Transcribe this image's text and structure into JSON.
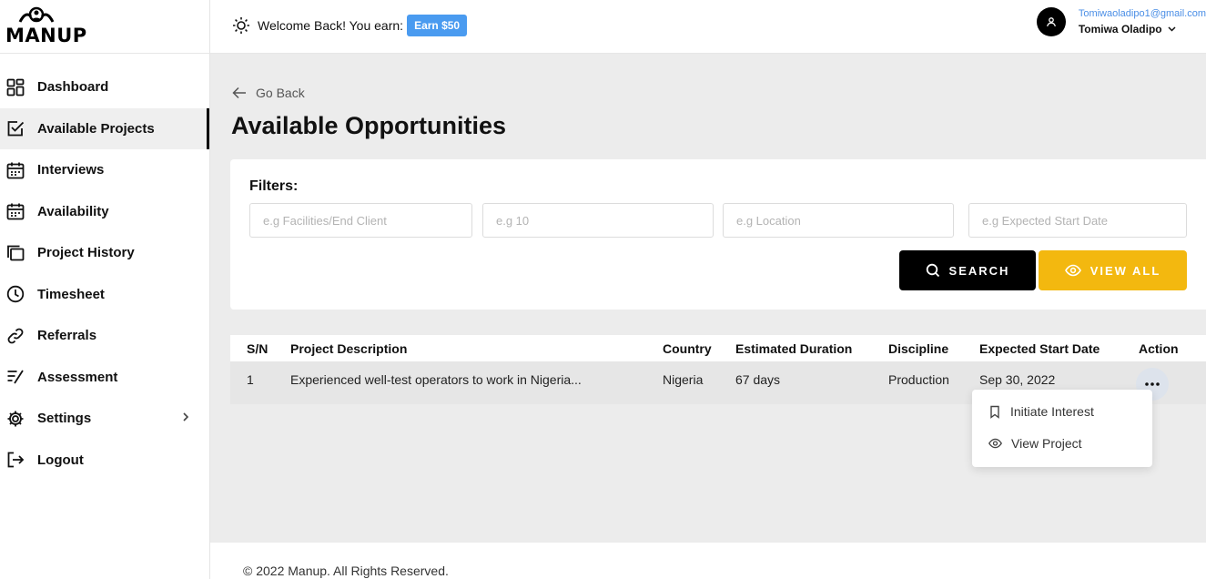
{
  "brand": {
    "name": "MANUP"
  },
  "sidebar": {
    "items": [
      {
        "label": "Dashboard",
        "icon": "grid-icon"
      },
      {
        "label": "Available Projects",
        "icon": "check-square-icon",
        "active": true
      },
      {
        "label": "Interviews",
        "icon": "calendar-icon"
      },
      {
        "label": "Availability",
        "icon": "calendar-icon"
      },
      {
        "label": "Project History",
        "icon": "folders-icon"
      },
      {
        "label": "Timesheet",
        "icon": "clock-icon"
      },
      {
        "label": "Referrals",
        "icon": "link-icon"
      },
      {
        "label": "Assessment",
        "icon": "assessment-icon"
      },
      {
        "label": "Settings",
        "icon": "gear-icon"
      },
      {
        "label": "Logout",
        "icon": "logout-icon"
      }
    ]
  },
  "header": {
    "welcome_text": "Welcome Back! You earn:",
    "earn_badge": "Earn $50",
    "user_email": "Tomiwaoladipo1@gmail.com",
    "user_name": "Tomiwa Oladipo"
  },
  "main": {
    "go_back": "Go Back",
    "title": "Available Opportunities",
    "filters": {
      "label": "Filters:",
      "fields": [
        {
          "placeholder": "e.g Facilities/End Client",
          "value": ""
        },
        {
          "placeholder": "e.g 10",
          "value": ""
        },
        {
          "placeholder": "e.g Location",
          "value": ""
        },
        {
          "placeholder": "e.g Expected Start Date",
          "value": ""
        }
      ],
      "search_label": "SEARCH",
      "view_all_label": "VIEW ALL"
    },
    "table": {
      "columns": [
        "S/N",
        "Project Description",
        "Country",
        "Estimated Duration",
        "Discipline",
        "Expected Start Date",
        "Action"
      ],
      "rows": [
        {
          "sn": "1",
          "description": "Experienced well-test operators to work in Nigeria...",
          "country": "Nigeria",
          "duration": "67 days",
          "discipline": "Production",
          "start_date": "Sep 30, 2022"
        }
      ]
    },
    "action_menu": {
      "items": [
        {
          "label": "Initiate Interest",
          "icon": "bookmark-icon"
        },
        {
          "label": "View Project",
          "icon": "eye-icon"
        }
      ]
    }
  },
  "footer": {
    "text": "© 2022 Manup. All Rights Reserved."
  },
  "colors": {
    "accent_blue": "#4a9bf0",
    "yellow": "#f3b80f",
    "black": "#000000"
  }
}
